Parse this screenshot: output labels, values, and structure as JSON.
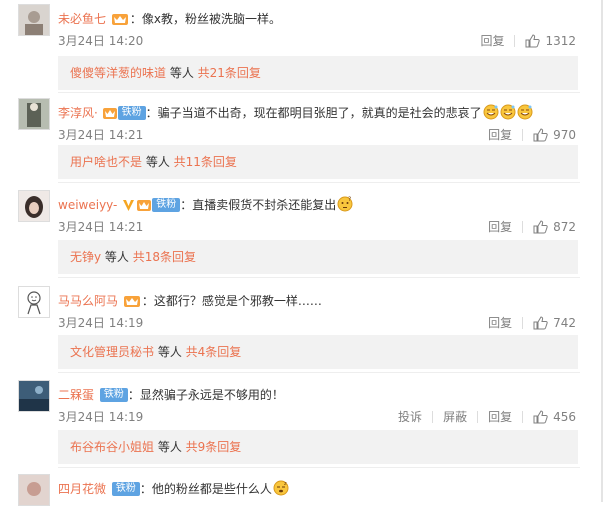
{
  "comments": [
    {
      "user": "未必鱼七",
      "badge": "fan-crown",
      "text": "：像x教，粉丝被洗脑一样。",
      "time": "3月24日 14:20",
      "reply_label": "回复",
      "likes": "1312",
      "sub": {
        "who": "傻傻等洋葱的味道",
        "mid": " 等人 ",
        "count": "共21条回复"
      }
    },
    {
      "user": "李淳风·",
      "badge": "fan-tiefen-crown",
      "badge_text": "铁粉",
      "text": "：骗子当道不出奇，现在都明目张胆了，就真的是社会的悲哀了",
      "emojis": [
        "sweat-smile",
        "sweat-smile",
        "sweat-smile"
      ],
      "time": "3月24日 14:21",
      "reply_label": "回复",
      "likes": "970",
      "sub": {
        "who": "用户啥也不是",
        "mid": " 等人 ",
        "count": "共11条回复"
      }
    },
    {
      "user": "weiweiyy-",
      "badge": "verified-v-tiefen",
      "badge_text": "铁粉",
      "text": "：直播卖假货不封杀还能复出",
      "emojis": [
        "doubt"
      ],
      "time": "3月24日 14:21",
      "reply_label": "回复",
      "likes": "872",
      "sub": {
        "who": "无铮y",
        "mid": " 等人 ",
        "count": "共18条回复"
      }
    },
    {
      "user": "马马么阿马",
      "badge": "fan-crown",
      "text": "：这都行？感觉是个邪教一样……",
      "time": "3月24日 14:19",
      "reply_label": "回复",
      "likes": "742",
      "sub": {
        "who": "文化管理员秘书",
        "mid": " 等人 ",
        "count": "共4条回复"
      }
    },
    {
      "user": "二槑蛋",
      "badge": "tiefen",
      "badge_text": "铁粉",
      "text": "：显然骗子永远是不够用的！",
      "time": "3月24日 14:19",
      "report_label": "投诉",
      "block_label": "屏蔽",
      "reply_label": "回复",
      "likes": "456",
      "sub": {
        "who": "布谷布谷小姐姐",
        "mid": " 等人 ",
        "count": "共9条回复"
      }
    },
    {
      "user": "四月花微",
      "badge": "tiefen",
      "badge_text": "铁粉",
      "text": "：他的粉丝都是些什么人",
      "emojis": [
        "sleepy"
      ]
    }
  ],
  "colors": {
    "username": "#eb7350",
    "tiefen": "#5ea3e2",
    "replybox_bg": "#f2f2f2"
  }
}
